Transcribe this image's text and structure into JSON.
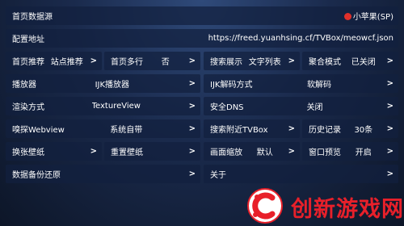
{
  "settings": {
    "home_source": {
      "label": "首页数据源",
      "value": "小苹果(SP)"
    },
    "config_url": {
      "label": "配置地址",
      "value": "https://freed.yuanhsing.cf/TVBox/meowcf.json"
    },
    "home_recommend": {
      "label": "首页推荐",
      "value": "站点推荐"
    },
    "home_multirow": {
      "label": "首页多行",
      "value": "否"
    },
    "search_display": {
      "label": "搜索展示",
      "value": "文字列表"
    },
    "aggregate_mode": {
      "label": "聚合模式",
      "value": "已关闭"
    },
    "player": {
      "label": "播放器",
      "value": "IJK播放器"
    },
    "ijk_decode": {
      "label": "IJK解码方式",
      "value": "软解码"
    },
    "render_mode": {
      "label": "渲染方式",
      "value": "TextureView"
    },
    "secure_dns": {
      "label": "安全DNS",
      "value": "关闭"
    },
    "sniff_webview": {
      "label": "嗅探Webview",
      "value": "系统自带"
    },
    "search_nearby": {
      "label": "搜索附近TVBox"
    },
    "history": {
      "label": "历史记录",
      "value": "30条"
    },
    "change_wallpaper": {
      "label": "换张壁纸"
    },
    "reset_wallpaper": {
      "label": "重置壁纸"
    },
    "screen_scale": {
      "label": "画面缩放",
      "value": "默认"
    },
    "window_preview": {
      "label": "窗口预览",
      "value": "开启"
    },
    "backup_restore": {
      "label": "数据备份还原"
    },
    "about": {
      "label": "关于"
    }
  },
  "arrow": ">",
  "watermark": {
    "text": "创新游戏网"
  },
  "colors": {
    "accent_red": "#e8202a",
    "apple_red": "#e0302a",
    "panel": "#12203e"
  }
}
